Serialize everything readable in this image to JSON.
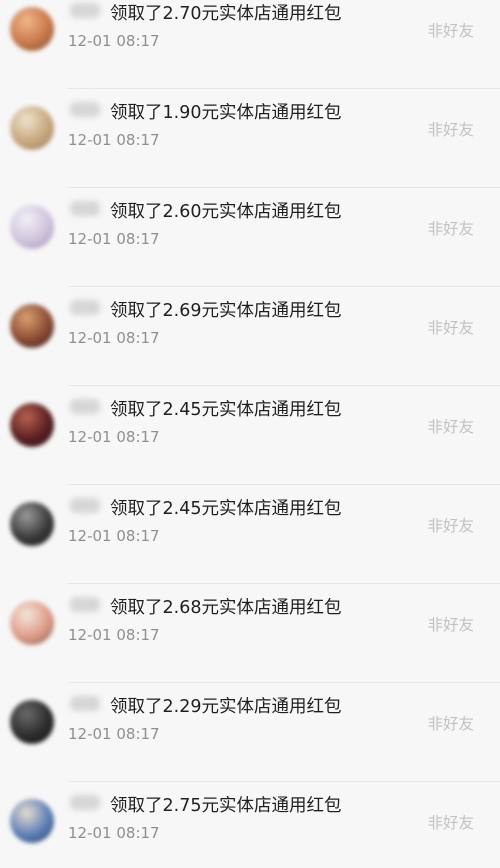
{
  "records": [
    {
      "message": "领取了2.70元实体店通用红包",
      "time": "12-01 08:17",
      "status": "非好友",
      "avatar_colors": [
        "#f0b68a",
        "#c9784a",
        "#6b4a3a"
      ]
    },
    {
      "message": "领取了1.90元实体店通用红包",
      "time": "12-01 08:17",
      "status": "非好友",
      "avatar_colors": [
        "#efe2cc",
        "#c8a67e",
        "#8f7a5c"
      ]
    },
    {
      "message": "领取了2.60元实体店通用红包",
      "time": "12-01 08:17",
      "status": "非好友",
      "avatar_colors": [
        "#f3f0f6",
        "#cfc3dc",
        "#9e8fb5"
      ]
    },
    {
      "message": "领取了2.69元实体店通用红包",
      "time": "12-01 08:17",
      "status": "非好友",
      "avatar_colors": [
        "#d9a071",
        "#8a4a33",
        "#2e2325"
      ]
    },
    {
      "message": "领取了2.45元实体店通用红包",
      "time": "12-01 08:17",
      "status": "非好友",
      "avatar_colors": [
        "#b8614f",
        "#5a1f22",
        "#1a1216"
      ]
    },
    {
      "message": "领取了2.45元实体店通用红包",
      "time": "12-01 08:17",
      "status": "非好友",
      "avatar_colors": [
        "#9a9a9a",
        "#3a3a3a",
        "#121212"
      ]
    },
    {
      "message": "领取了2.68元实体店通用红包",
      "time": "12-01 08:17",
      "status": "非好友",
      "avatar_colors": [
        "#f4e6da",
        "#e09a88",
        "#6e5a4c"
      ]
    },
    {
      "message": "领取了2.29元实体店通用红包",
      "time": "12-01 08:17",
      "status": "非好友",
      "avatar_colors": [
        "#6a6a6a",
        "#2c2c2c",
        "#0e0e0e"
      ]
    },
    {
      "message": "领取了2.75元实体店通用红包",
      "time": "12-01 08:17",
      "status": "非好友",
      "avatar_colors": [
        "#e8dccf",
        "#5c7fb8",
        "#2a3550"
      ]
    }
  ]
}
